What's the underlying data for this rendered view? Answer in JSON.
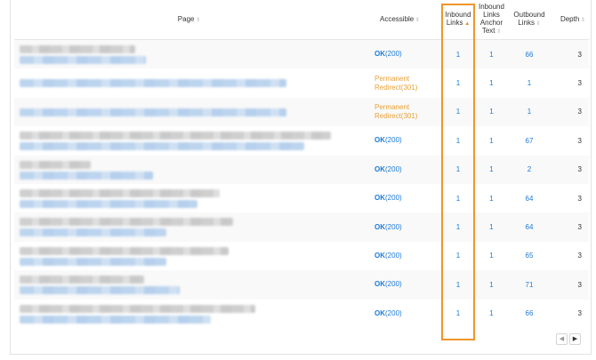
{
  "table": {
    "columns": [
      {
        "key": "page",
        "label": "Page",
        "sort": "unsorted"
      },
      {
        "key": "accessible",
        "label": "Accessible",
        "sort": "unsorted"
      },
      {
        "key": "inbound",
        "label": "Inbound Links",
        "sort": "ascending"
      },
      {
        "key": "anchor",
        "label": "Inbound Links Anchor Text",
        "sort": "unsorted"
      },
      {
        "key": "outbound",
        "label": "Outbound Links",
        "sort": "unsorted"
      },
      {
        "key": "depth",
        "label": "Depth",
        "sort": "unsorted"
      }
    ],
    "rows": [
      {
        "status_word": "OK",
        "status_code": "(200)",
        "status_type": "ok",
        "inbound": "1",
        "anchor": "1",
        "outbound": "66",
        "depth": "3"
      },
      {
        "status_word": "Permanent",
        "status_code": "Redirect(301)",
        "status_type": "redirect",
        "inbound": "1",
        "anchor": "1",
        "outbound": "1",
        "depth": "3"
      },
      {
        "status_word": "Permanent",
        "status_code": "Redirect(301)",
        "status_type": "redirect",
        "inbound": "1",
        "anchor": "1",
        "outbound": "1",
        "depth": "3"
      },
      {
        "status_word": "OK",
        "status_code": "(200)",
        "status_type": "ok",
        "inbound": "1",
        "anchor": "1",
        "outbound": "67",
        "depth": "3"
      },
      {
        "status_word": "OK",
        "status_code": "(200)",
        "status_type": "ok",
        "inbound": "1",
        "anchor": "1",
        "outbound": "2",
        "depth": "3"
      },
      {
        "status_word": "OK",
        "status_code": "(200)",
        "status_type": "ok",
        "inbound": "1",
        "anchor": "1",
        "outbound": "64",
        "depth": "3"
      },
      {
        "status_word": "OK",
        "status_code": "(200)",
        "status_type": "ok",
        "inbound": "1",
        "anchor": "1",
        "outbound": "64",
        "depth": "3"
      },
      {
        "status_word": "OK",
        "status_code": "(200)",
        "status_type": "ok",
        "inbound": "1",
        "anchor": "1",
        "outbound": "65",
        "depth": "3"
      },
      {
        "status_word": "OK",
        "status_code": "(200)",
        "status_type": "ok",
        "inbound": "1",
        "anchor": "1",
        "outbound": "71",
        "depth": "3"
      },
      {
        "status_word": "OK",
        "status_code": "(200)",
        "status_type": "ok",
        "inbound": "1",
        "anchor": "1",
        "outbound": "66",
        "depth": "3"
      }
    ]
  },
  "pagination": {
    "prev_icon": "chevron-left-icon",
    "next_icon": "chevron-right-icon"
  },
  "colors": {
    "link": "#1d7ad6",
    "redirect": "#e8a33a",
    "highlight": "#f0962a",
    "sort_active": "#e28c2a"
  }
}
